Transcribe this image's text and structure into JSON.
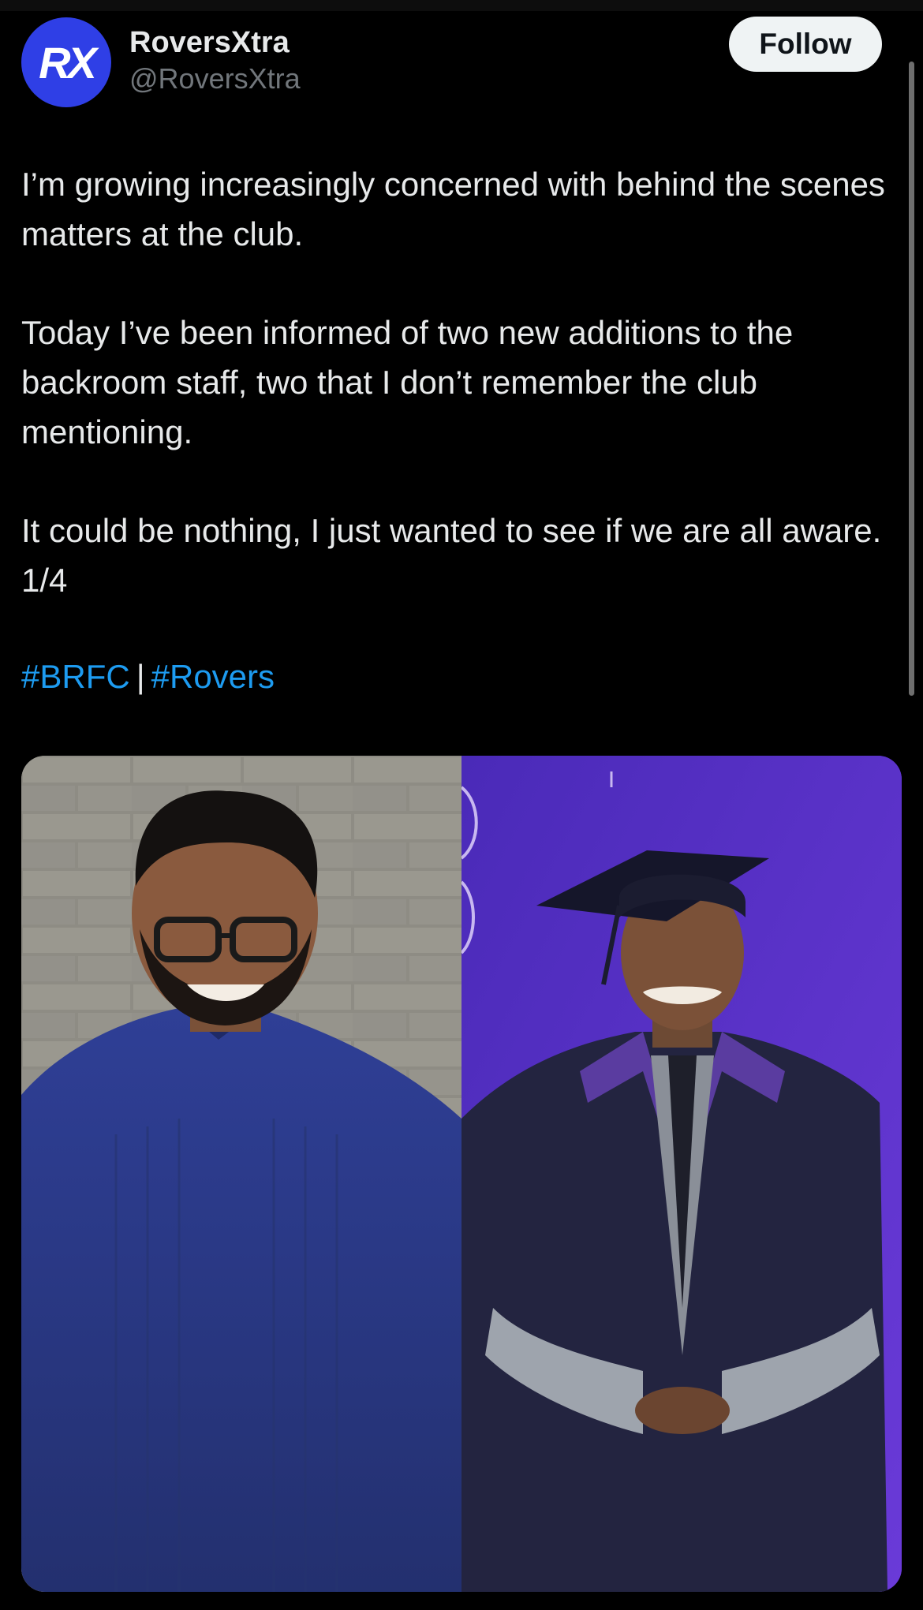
{
  "author": {
    "display_name": "RoversXtra",
    "handle": "@RoversXtra",
    "avatar_text": "RX",
    "avatar_color": "#2f3fe6"
  },
  "follow_button": {
    "label": "Follow"
  },
  "tweet": {
    "paragraphs": [
      "I’m growing increasingly concerned with behind the scenes matters at the club.",
      "Today I’ve been informed of two new additions to the backroom staff, two that I don’t remember the club mentioning.",
      "It could be nothing, I just wanted to see if we are all aware. 1/4"
    ],
    "hashtags": [
      "#BRFC",
      "#Rovers"
    ],
    "hashtag_separator": "|"
  },
  "media": {
    "left_photo": {
      "description_icon": "photo-person-blue-shirt"
    },
    "right_photo": {
      "description_icon": "photo-person-graduation-gown"
    }
  },
  "colors": {
    "background": "#000000",
    "text": "#e7e9ea",
    "muted": "#71767b",
    "link": "#1d9bf0",
    "button_bg": "#eff3f4"
  }
}
